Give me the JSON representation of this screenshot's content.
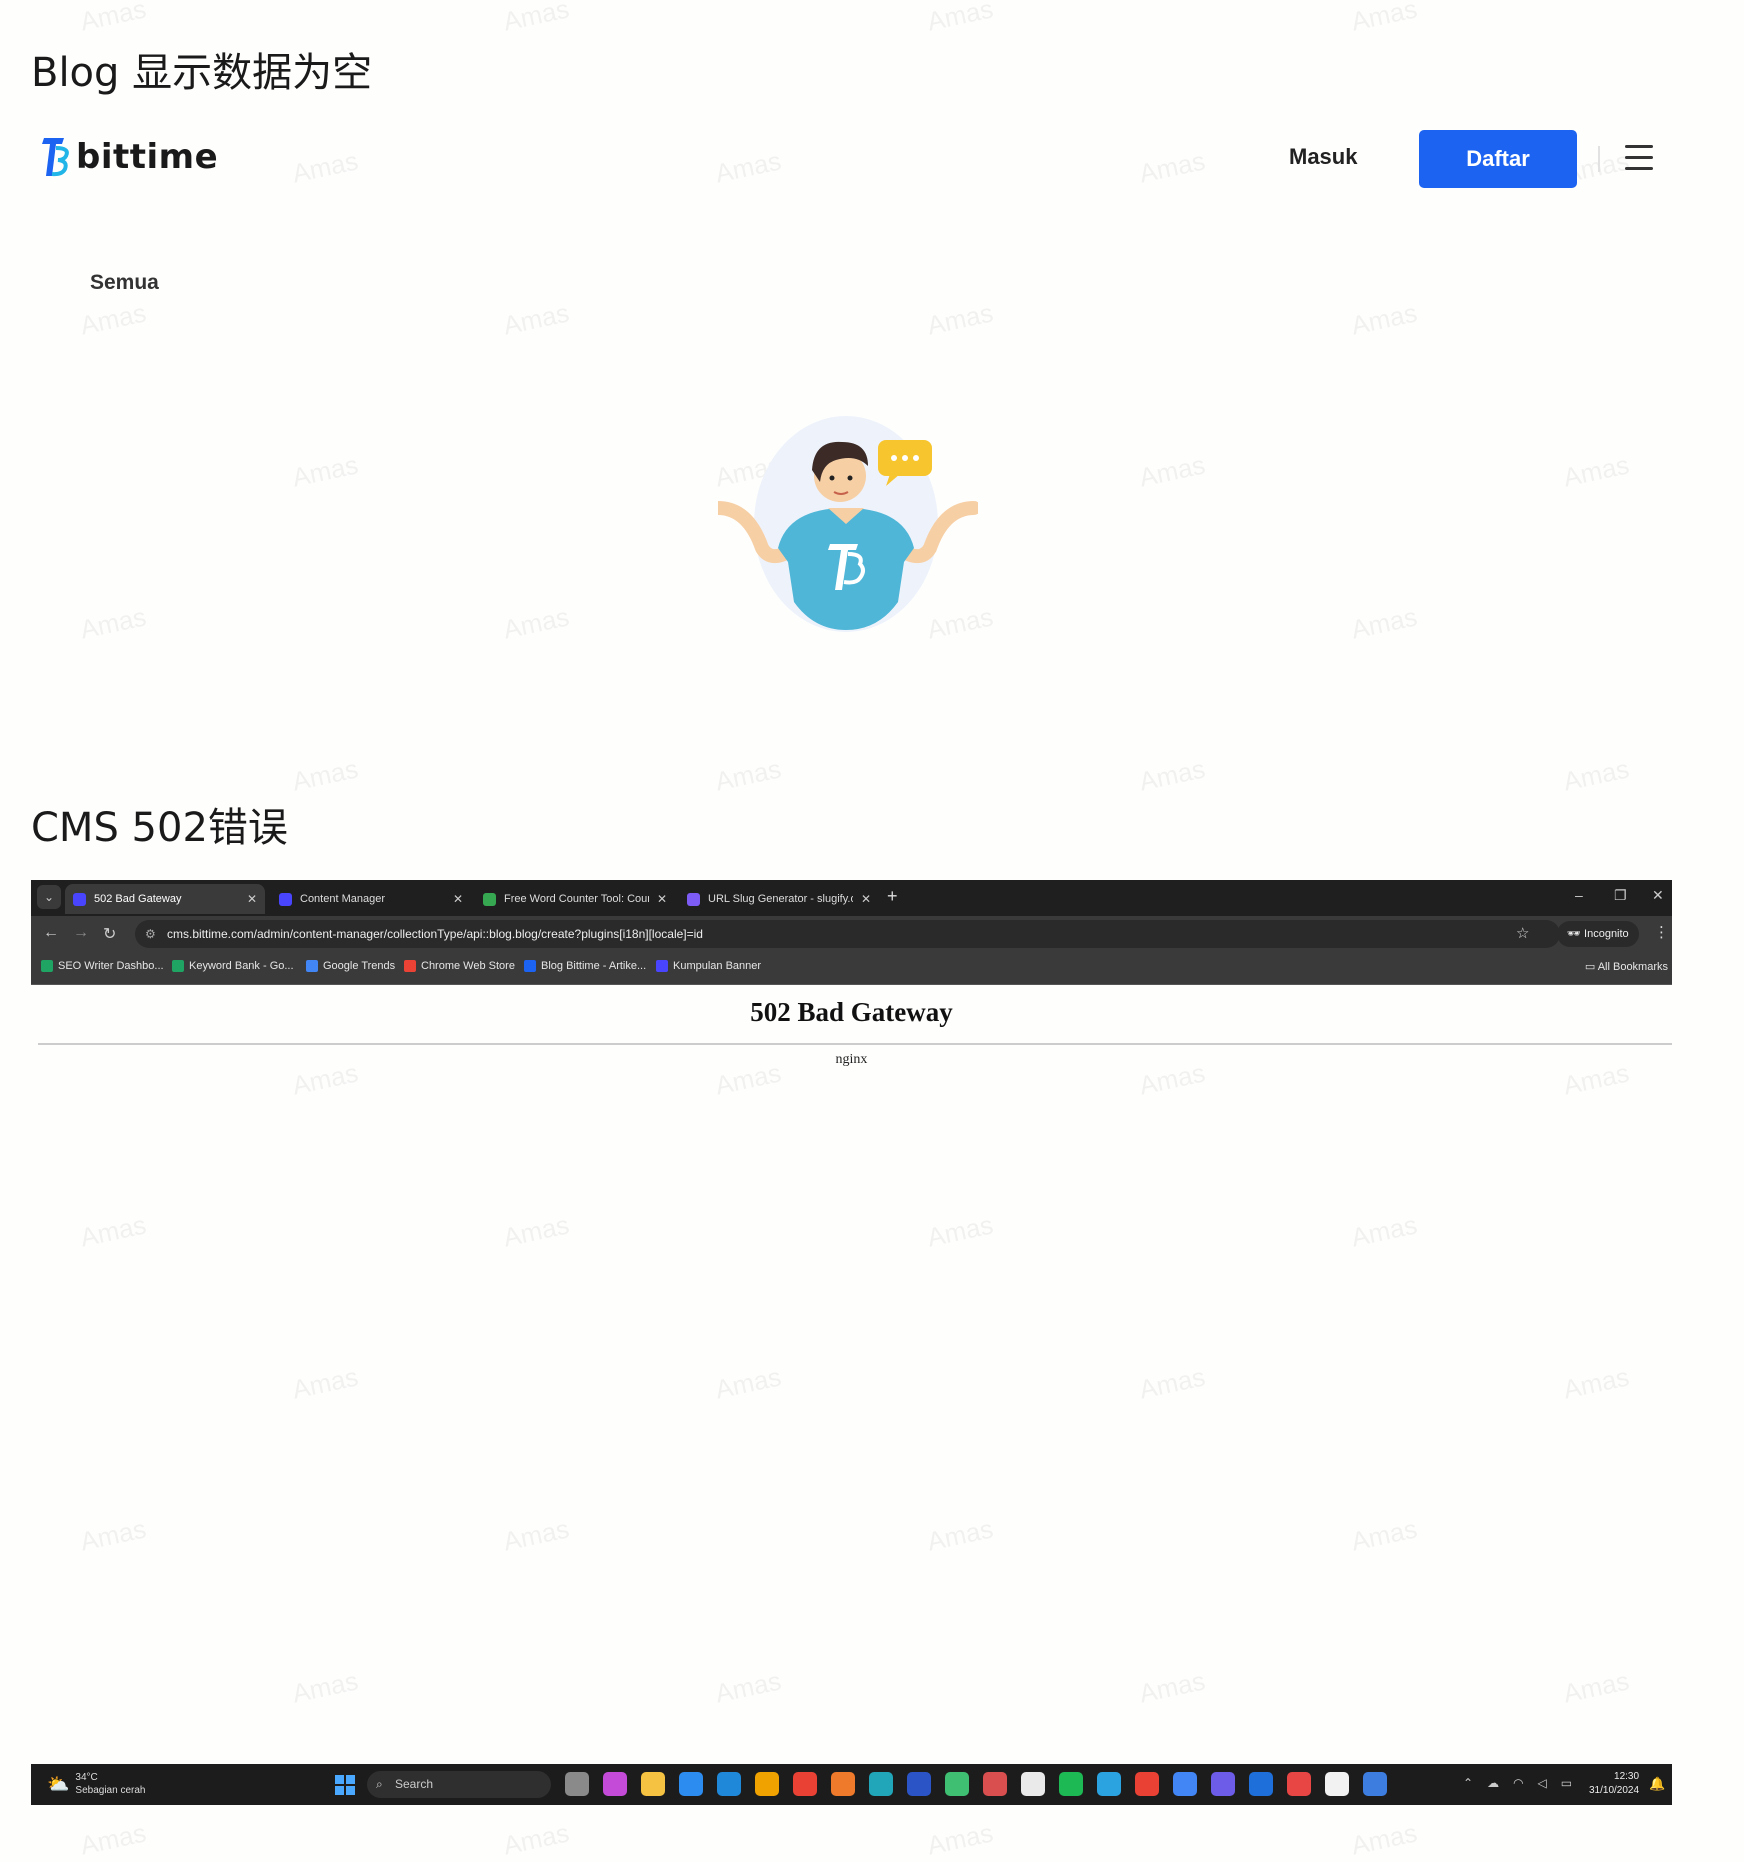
{
  "sections": {
    "blog_title": "Blog 显示数据为空",
    "cms_title": "CMS 502错误"
  },
  "blog": {
    "logo_text": "bittime",
    "login_label": "Masuk",
    "register_label": "Daftar",
    "filter_tab": "Semua",
    "accent_color": "#1c63f1"
  },
  "browser": {
    "tabs": [
      {
        "label": "502 Bad Gateway",
        "active": true
      },
      {
        "label": "Content Manager",
        "active": false
      },
      {
        "label": "Free Word Counter Tool: Count",
        "active": false
      },
      {
        "label": "URL Slug Generator - slugify.on",
        "active": false
      }
    ],
    "url": "cms.bittime.com/admin/content-manager/collectionType/api::blog.blog/create?plugins[i18n][locale]=id",
    "incognito_label": "Incognito",
    "bookmarks": [
      {
        "label": "SEO Writer Dashbo...",
        "icon": "sheets-icon"
      },
      {
        "label": "Keyword Bank - Go...",
        "icon": "sheets-icon"
      },
      {
        "label": "Google Trends",
        "icon": "trends-icon"
      },
      {
        "label": "Chrome Web Store",
        "icon": "store-icon"
      },
      {
        "label": "Blog Bittime - Artike...",
        "icon": "bittime-icon"
      },
      {
        "label": "Kumpulan Banner",
        "icon": "strapi-icon"
      }
    ],
    "all_bookmarks": "All Bookmarks"
  },
  "error_page": {
    "heading": "502 Bad Gateway",
    "server": "nginx"
  },
  "taskbar": {
    "temperature": "34°C",
    "weather": "Sebagian cerah",
    "search_placeholder": "Search",
    "time": "12:30",
    "date": "31/10/2024"
  },
  "watermark": "Amas"
}
